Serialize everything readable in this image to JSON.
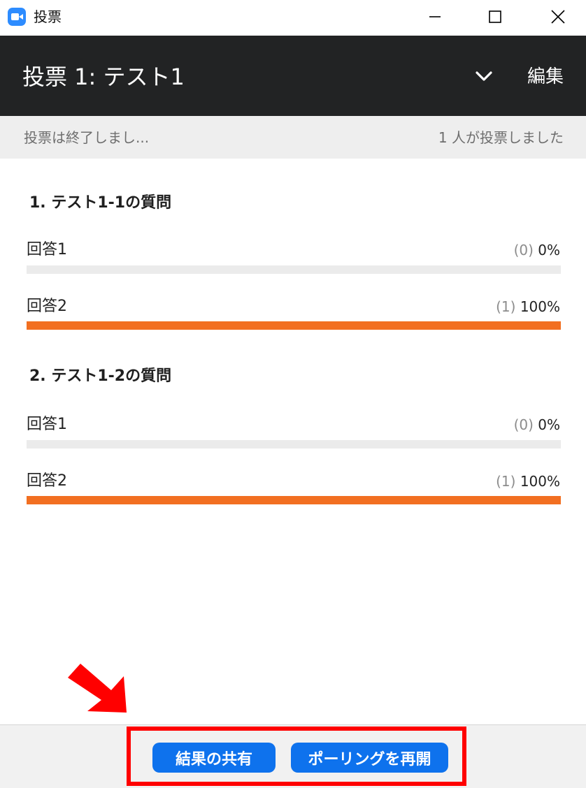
{
  "window": {
    "title": "投票",
    "icon": "zoom-camera-icon",
    "controls": [
      "minimize-icon",
      "maximize-icon",
      "close-icon"
    ]
  },
  "header": {
    "title": "投票 1: テスト1",
    "dropdown_icon": "chevron-down-icon",
    "edit_label": "編集"
  },
  "status": {
    "left": "投票は終了しまし...",
    "right": "1 人が投票しました"
  },
  "questions": [
    {
      "title": "1. テスト1-1の質問",
      "answers": [
        {
          "label": "回答1",
          "count": "(0)",
          "percent": "0%",
          "fraction": 0
        },
        {
          "label": "回答2",
          "count": "(1)",
          "percent": "100%",
          "fraction": 1
        }
      ]
    },
    {
      "title": "2. テスト1-2の質問",
      "answers": [
        {
          "label": "回答1",
          "count": "(0)",
          "percent": "0%",
          "fraction": 0
        },
        {
          "label": "回答2",
          "count": "(1)",
          "percent": "100%",
          "fraction": 1
        }
      ]
    }
  ],
  "footer": {
    "share_label": "結果の共有",
    "reopen_label": "ポーリングを再開"
  },
  "colors": {
    "accent_bar": "#f26f21",
    "button": "#0e72ed",
    "header_bg": "#222324",
    "annotation": "#ff0000"
  },
  "annotation": {
    "arrow_icon": "red-arrow-icon"
  }
}
